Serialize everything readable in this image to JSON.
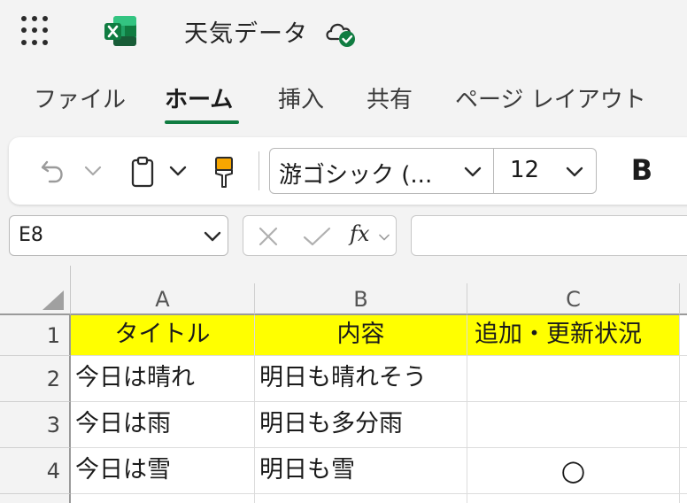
{
  "app": {
    "document_title": "天気データ",
    "brand_color": "#107c41",
    "icons": [
      "app-launcher-icon",
      "excel-logo-icon",
      "cloud-saved-icon"
    ]
  },
  "tabs": [
    {
      "label": "ファイル",
      "active": false
    },
    {
      "label": "ホーム",
      "active": true
    },
    {
      "label": "挿入",
      "active": false
    },
    {
      "label": "共有",
      "active": false
    },
    {
      "label": "ページ レイアウト",
      "active": false
    }
  ],
  "ribbon": {
    "font_name": "游ゴシック (...",
    "font_size": "12",
    "bold_label": "B"
  },
  "formula_bar": {
    "name_box": "E8",
    "fx_label": "fx",
    "formula_value": ""
  },
  "sheet": {
    "header_fill": "#ffff00",
    "columns": [
      "A",
      "B",
      "C"
    ],
    "rows": [
      {
        "num": "1",
        "cells": [
          "タイトル",
          "内容",
          "追加・更新状況"
        ]
      },
      {
        "num": "2",
        "cells": [
          "今日は晴れ",
          "明日も晴れそう",
          ""
        ]
      },
      {
        "num": "3",
        "cells": [
          "今日は雨",
          "明日も多分雨",
          ""
        ]
      },
      {
        "num": "4",
        "cells": [
          "今日は雪",
          "明日も雪",
          "○"
        ]
      }
    ]
  }
}
